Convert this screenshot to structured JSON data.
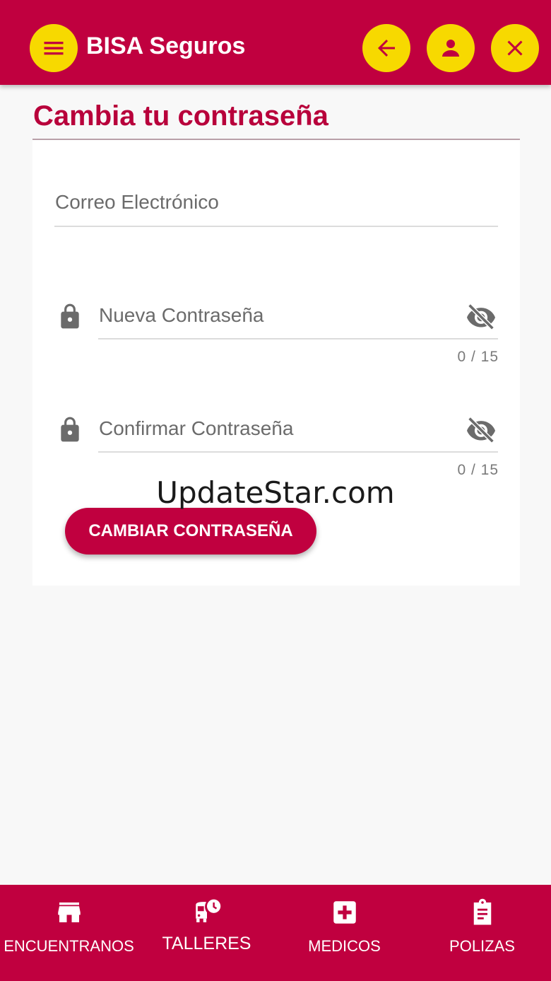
{
  "header": {
    "title": "BISA Seguros",
    "menu_icon": "menu-icon",
    "back_icon": "arrow-left-icon",
    "user_icon": "user-icon",
    "close_icon": "close-icon"
  },
  "page": {
    "title": "Cambia tu contraseña"
  },
  "form": {
    "email": {
      "label": "Correo Electrónico",
      "value": ""
    },
    "new_password": {
      "label": "Nueva Contraseña",
      "value": "",
      "counter": "0 / 15",
      "icon": "lock-icon",
      "toggle_icon": "eye-off-icon"
    },
    "confirm_password": {
      "label": "Confirmar Contraseña",
      "value": "",
      "counter": "0 / 15",
      "icon": "lock-icon",
      "toggle_icon": "eye-off-icon"
    },
    "submit_label": "CAMBIAR CONTRASEÑA"
  },
  "watermark": "UpdateStar.com",
  "bottom_nav": {
    "items": [
      {
        "label": "ENCUENTRANOS",
        "icon": "store-icon"
      },
      {
        "label": "TALLERES",
        "icon": "bus-clock-icon"
      },
      {
        "label": "MEDICOS",
        "icon": "medical-cross-icon"
      },
      {
        "label": "POLIZAS",
        "icon": "clipboard-icon"
      }
    ]
  },
  "colors": {
    "brand": "#c0003f",
    "accent": "#f7d900",
    "title": "#b8003b"
  }
}
